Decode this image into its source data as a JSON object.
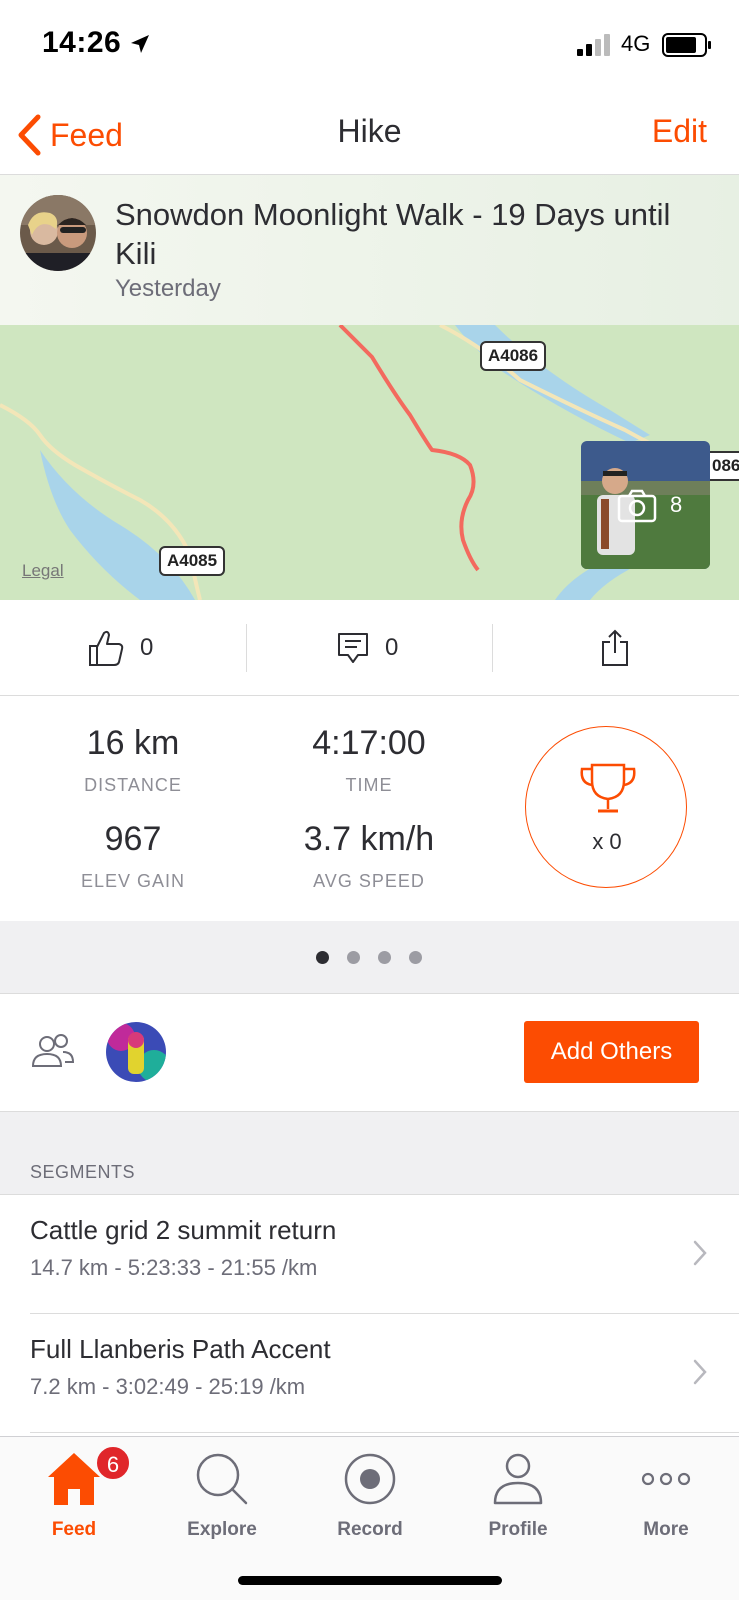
{
  "status_bar": {
    "time": "14:26",
    "network": "4G"
  },
  "nav": {
    "back_label": "Feed",
    "title": "Hike",
    "edit_label": "Edit"
  },
  "activity": {
    "title": "Snowdon Moonlight Walk - 19 Days until Kili",
    "date": "Yesterday"
  },
  "map": {
    "road_labels": [
      "A4086",
      "A4085",
      "086"
    ],
    "legal_label": "Legal",
    "photo_count": "8"
  },
  "actions": {
    "kudos_count": "0",
    "comments_count": "0"
  },
  "stats": {
    "distance": {
      "value": "16 km",
      "label": "DISTANCE"
    },
    "time": {
      "value": "4:17:00",
      "label": "TIME"
    },
    "elev_gain": {
      "value": "967",
      "label": "ELEV GAIN"
    },
    "avg_speed": {
      "value": "3.7 km/h",
      "label": "AVG SPEED"
    },
    "achievements": "x 0"
  },
  "pager": {
    "pages": 4,
    "active": 1
  },
  "group": {
    "add_others_label": "Add Others"
  },
  "segments": {
    "header": "SEGMENTS",
    "items": [
      {
        "name": "Cattle grid 2 summit return",
        "detail": "14.7 km - 5:23:33 - 21:55 /km"
      },
      {
        "name": "Full Llanberis Path Accent",
        "detail": "7.2 km - 3:02:49 - 25:19 /km"
      }
    ]
  },
  "tabs": [
    {
      "label": "Feed",
      "icon": "home-icon",
      "badge": "6"
    },
    {
      "label": "Explore",
      "icon": "search-icon"
    },
    {
      "label": "Record",
      "icon": "record-icon"
    },
    {
      "label": "Profile",
      "icon": "profile-icon"
    },
    {
      "label": "More",
      "icon": "more-icon"
    }
  ],
  "colors": {
    "accent": "#fc4c02",
    "route": "#f36a5e",
    "map_green": "#cfe6c0",
    "water": "#a9d4ea",
    "badge": "#e0262a"
  }
}
